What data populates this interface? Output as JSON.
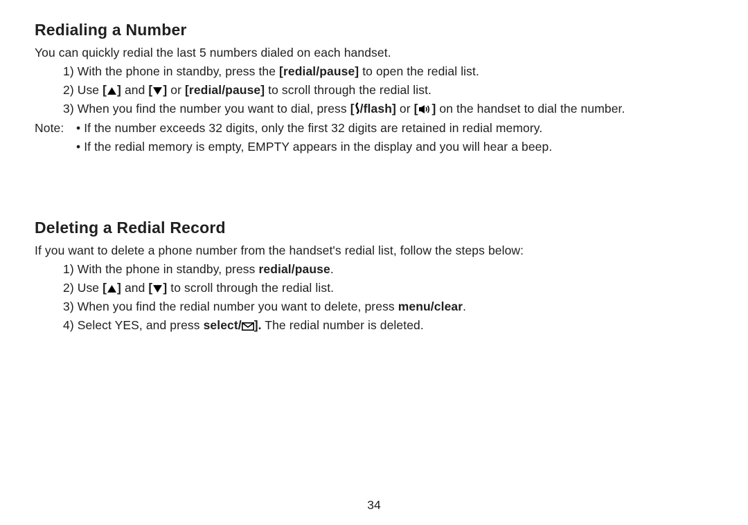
{
  "section1": {
    "heading": "Redialing a Number",
    "intro": "You can quickly redial the last 5 numbers dialed on each handset.",
    "step1_a": "1) With the phone in standby, press the ",
    "step1_b": "[redial/pause]",
    "step1_c": " to open the redial list.",
    "step2_a": "2) Use ",
    "step2_b": " and ",
    "step2_c": " or ",
    "step2_d": "redial/pause]",
    "step2_e": " to scroll through the redial list.",
    "step3_a": "3) When you find the number you want to dial, press ",
    "step3_b": "/flash]",
    "step3_c": " or ",
    "step3_d": " on the handset to dial the number.",
    "note_label": "Note:",
    "note1": "• If the number exceeds 32 digits, only the first 32 digits are retained in redial memory.",
    "note2": "• If the redial memory is empty, EMPTY appears in the display and you will hear a beep."
  },
  "section2": {
    "heading": "Deleting a Redial Record",
    "intro": "If you want to delete a phone number from the handset's redial list, follow the steps below:",
    "step1_a": "1) With the phone in standby, press ",
    "step1_b": "redial/pause",
    "step1_c": ".",
    "step2_a": "2) Use ",
    "step2_b": " and ",
    "step2_c": " to scroll through the redial list.",
    "step3_a": "3) When you find the redial number you want to delete, press ",
    "step3_b": "menu/clear",
    "step3_c": ".",
    "step4_a": "4) Select YES, and press ",
    "step4_b": "select/",
    "step4_c": " The redial number is deleted."
  },
  "page_number": "34"
}
